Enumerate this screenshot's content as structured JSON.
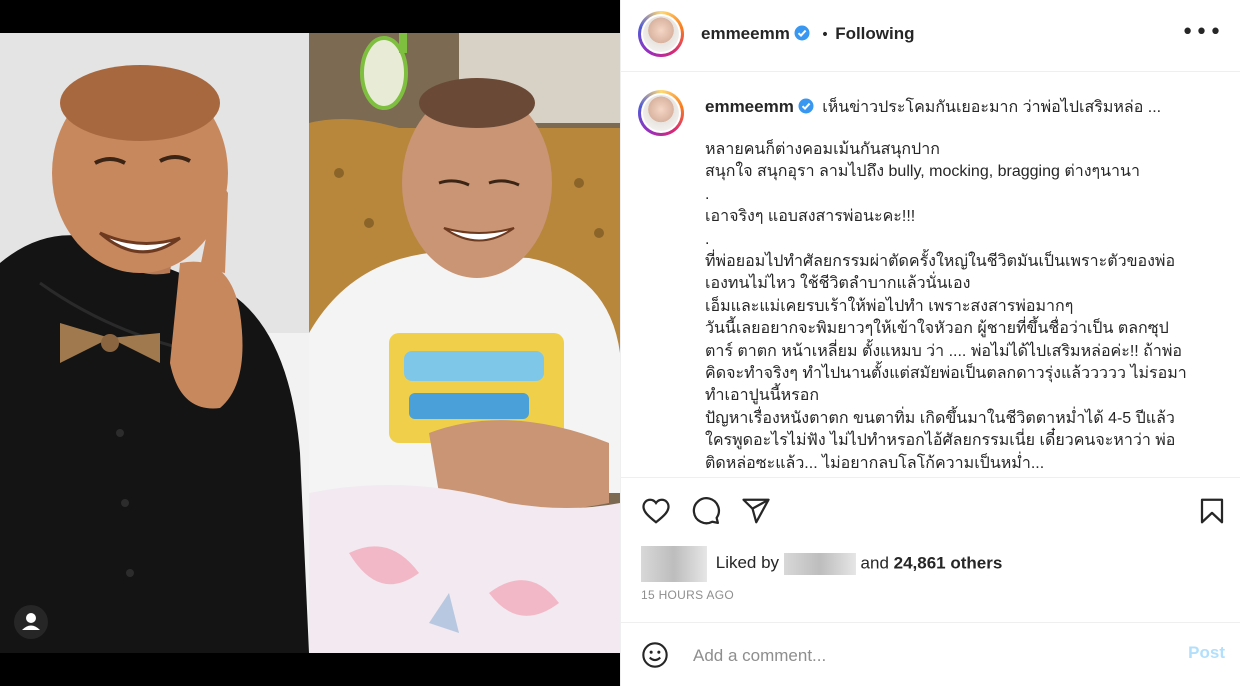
{
  "post": {
    "username": "emmeemm",
    "follow_status": "Following",
    "caption_first_line": "เห็นข่าวประโคมกันเยอะมาก ว่าพ่อไปเสริมหล่อ ...",
    "caption_body": "หลายคนก็ต่างคอมเม้นกันสนุกปาก\nสนุกใจ สนุกอุรา ลามไปถึง bully, mocking, bragging ต่างๆนานา\n.\nเอาจริงๆ แอบสงสารพ่อนะคะ!!!\n.\nที่พ่อยอมไปทำศัลยกรรมผ่าตัดครั้งใหญ่ในชีวิตมันเป็นเพราะตัวของพ่อ\nเองทนไม่ไหว ใช้ชีวิตลำบากแล้วนั่นเอง\nเอ็มและแม่เคยรบเร้าให้พ่อไปทำ เพราะสงสารพ่อมากๆ\nวันนี้เลยอยากจะพิมยาวๆให้เข้าใจหัวอก ผู้ชายที่ขึ้นชื่อว่าเป็น ตลกซุป\nตาร์ ตาตก หน้าเหลี่ยม ตั้งแหมบ ว่า .... พ่อไม่ได้ไปเสริมหล่อค่ะ!! ถ้าพ่อ\nคิดจะทำจริงๆ ทำไปนานตั้งแต่สมัยพ่อเป็นตลกดาวรุ่งแล้ววววว ไม่รอมา\nทำเอาปูนนี้หรอก\nปัญหาเรื่องหนังตาตก ขนตาทิ่ม เกิดขึ้นมาในชีวิตตาหม่ำได้ 4-5 ปีแล้ว\nใครพูดอะไรไม่ฟัง ไม่ไปทำหรอกไอ้ศัลยกรรมเนี่ย เดี๋ยวคนจะหาว่า พ่อ\nติดหล่อซะแล้ว... ไม่อยากลบโลโก้ความเป็นหม่ำ...",
    "liked_by_prefix": "Liked by",
    "liked_and": "and",
    "likes_others": "24,861 others",
    "timestamp": "15 HOURS AGO",
    "comment_placeholder": "Add a comment...",
    "post_button": "Post",
    "more_glyph": "•••",
    "dot_separator": "•"
  },
  "colors": {
    "verified": "#3897f0",
    "post_button_disabled": "#b2dffc",
    "meta_gray": "#8e8e8e"
  },
  "icons": [
    "heart-icon",
    "comment-icon",
    "share-icon",
    "bookmark-icon",
    "emoji-icon",
    "more-options-icon",
    "verified-badge-icon",
    "user-tag-icon"
  ]
}
